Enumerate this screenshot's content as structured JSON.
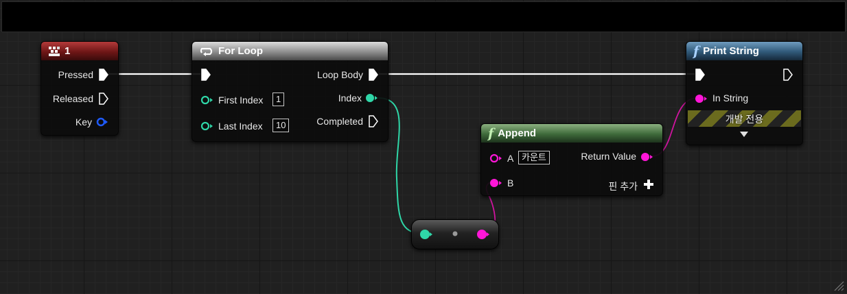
{
  "nodes": {
    "key_event": {
      "title": "1",
      "pins": {
        "pressed": "Pressed",
        "released": "Released",
        "key": "Key"
      }
    },
    "for_loop": {
      "title": "For Loop",
      "pins": {
        "first_index": "First Index",
        "first_index_value": "1",
        "last_index": "Last Index",
        "last_index_value": "10",
        "loop_body": "Loop Body",
        "index": "Index",
        "completed": "Completed"
      }
    },
    "print_string": {
      "title": "Print String",
      "pins": {
        "in_string": "In String"
      },
      "dev_only_label": "개발 전용"
    },
    "append": {
      "title": "Append",
      "pins": {
        "a": "A",
        "a_value": "카운트",
        "b": "B",
        "return_value": "Return Value",
        "add_pin": "핀 추가"
      }
    }
  },
  "colors": {
    "exec_wire": "#ffffff",
    "int_pin": "#2fd7a8",
    "string_pin": "#ff16d8",
    "key_pin": "#1f5bff",
    "event_header": "#8a1c1c",
    "function_header_blue": "#3a6a8e",
    "function_header_green": "#4a7a45",
    "macro_header": "#8f8f8f"
  },
  "icons": {
    "event": "key-event-icon",
    "loop": "loop-arrow-icon",
    "function": "function-f-icon",
    "add": "plus-icon",
    "expand": "triangle-down-icon",
    "resize": "resize-grip-icon"
  }
}
